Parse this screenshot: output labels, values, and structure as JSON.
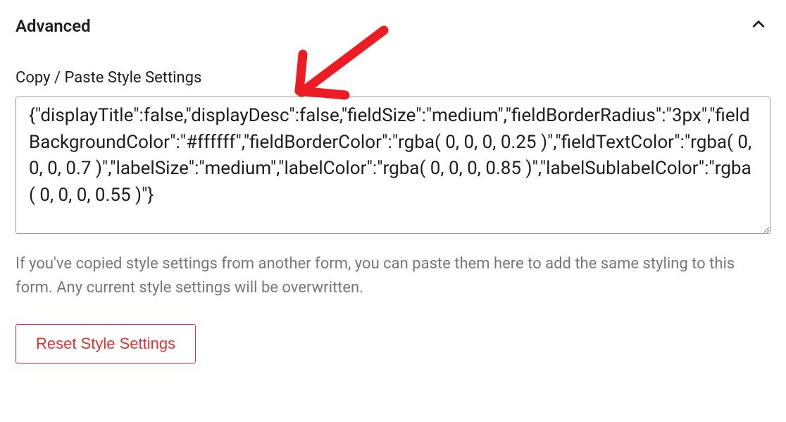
{
  "section": {
    "title": "Advanced"
  },
  "field": {
    "label": "Copy / Paste Style Settings",
    "value": "{\"displayTitle\":false,\"displayDesc\":false,\"fieldSize\":\"medium\",\"fieldBorderRadius\":\"3px\",\"fieldBackgroundColor\":\"#ffffff\",\"fieldBorderColor\":\"rgba( 0, 0, 0, 0.25 )\",\"fieldTextColor\":\"rgba( 0, 0, 0, 0.7 )\",\"labelSize\":\"medium\",\"labelColor\":\"rgba( 0, 0, 0, 0.85 )\",\"labelSublabelColor\":\"rgba( 0, 0, 0, 0.55 )\"}"
  },
  "help_text": "If you've copied style settings from another form, you can paste them here to add the same styling to this form. Any current style settings will be overwritten.",
  "reset_button_label": "Reset Style Settings"
}
